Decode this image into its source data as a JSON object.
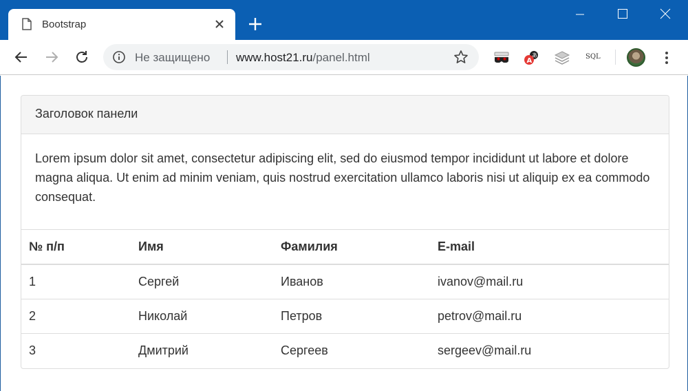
{
  "browser": {
    "tab_title": "Bootstrap",
    "security_label": "Не защищено",
    "url_host": "www.host21.ru",
    "url_path": "/panel.html",
    "extensions": [
      "incognito-mask-icon",
      "translate-icon",
      "layers-icon",
      "sql-icon"
    ],
    "sql_label": "SQL",
    "accent_color": "#0b5fb3"
  },
  "panel": {
    "heading": "Заголовок панели",
    "body": "Lorem ipsum dolor sit amet, consectetur adipiscing elit, sed do eiusmod tempor incididunt ut labore et dolore magna aliqua. Ut enim ad minim veniam, quis nostrud exercitation ullamco laboris nisi ut aliquip ex ea commodo consequat."
  },
  "table": {
    "headers": [
      "№ п/п",
      "Имя",
      "Фамилия",
      "E-mail"
    ],
    "rows": [
      [
        "1",
        "Сергей",
        "Иванов",
        "ivanov@mail.ru"
      ],
      [
        "2",
        "Николай",
        "Петров",
        "petrov@mail.ru"
      ],
      [
        "3",
        "Дмитрий",
        "Сергеев",
        "sergeev@mail.ru"
      ]
    ]
  }
}
